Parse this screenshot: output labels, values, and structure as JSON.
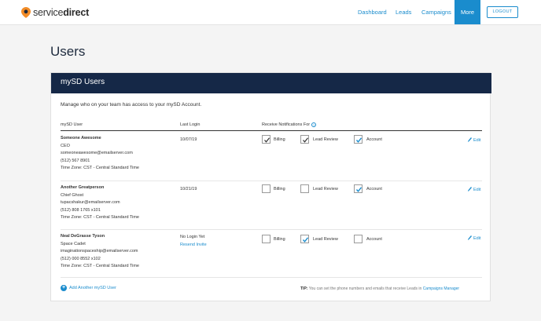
{
  "brand": {
    "name_light": "service",
    "name_bold": "direct",
    "accent": "#f28c28"
  },
  "nav": {
    "items": [
      "Dashboard",
      "Leads",
      "Campaigns",
      "More"
    ],
    "logout": "LOGOUT"
  },
  "page": {
    "title": "Users"
  },
  "card": {
    "title": "mySD Users",
    "intro": "Manage who on your team has access to your mySD Account.",
    "headers": {
      "user": "mySD User",
      "login": "Last Login",
      "notif": "Receive Notifications For"
    },
    "help_glyph": "?",
    "notif_labels": [
      "Billing",
      "Lead Review",
      "Account"
    ],
    "edit_label": "Edit",
    "users": [
      {
        "name": "Someone Awesome",
        "role": "CEO",
        "email": "someoneawesome@emailserver.com",
        "phone": "(512) 567 8901",
        "tz": "Time Zone: CST - Central Standard Time",
        "last_login": "10/07/19",
        "resend": "",
        "billing": true,
        "lead_review": true,
        "account": true
      },
      {
        "name": "Another Greatperson",
        "role": "Chief Ghost",
        "email": "tupacshakur@emailserver.com",
        "phone": "(512) 808 1765 x101",
        "tz": "Time Zone: CST - Central Standard Time",
        "last_login": "10/21/19",
        "resend": "",
        "billing": false,
        "lead_review": false,
        "account": true
      },
      {
        "name": "Neal DeGrasse Tyson",
        "role": "Space Cadet",
        "email": "imaginationspaceship@emailserver.com",
        "phone": "(512) 000 8552 x102",
        "tz": "Time Zone: CST - Central Standard Time",
        "last_login": "No Login Yet",
        "resend": "Resend Invite",
        "billing": false,
        "lead_review": true,
        "account": false
      }
    ],
    "add_user": "Add Another mySD User",
    "tip": {
      "prefix": "TIP:",
      "text": "You can set the phone numbers and emails that receive Leads in",
      "link": "Campaigns Manager"
    }
  },
  "colors": {
    "primary": "#1a8ccd",
    "header_bg": "#152847"
  }
}
